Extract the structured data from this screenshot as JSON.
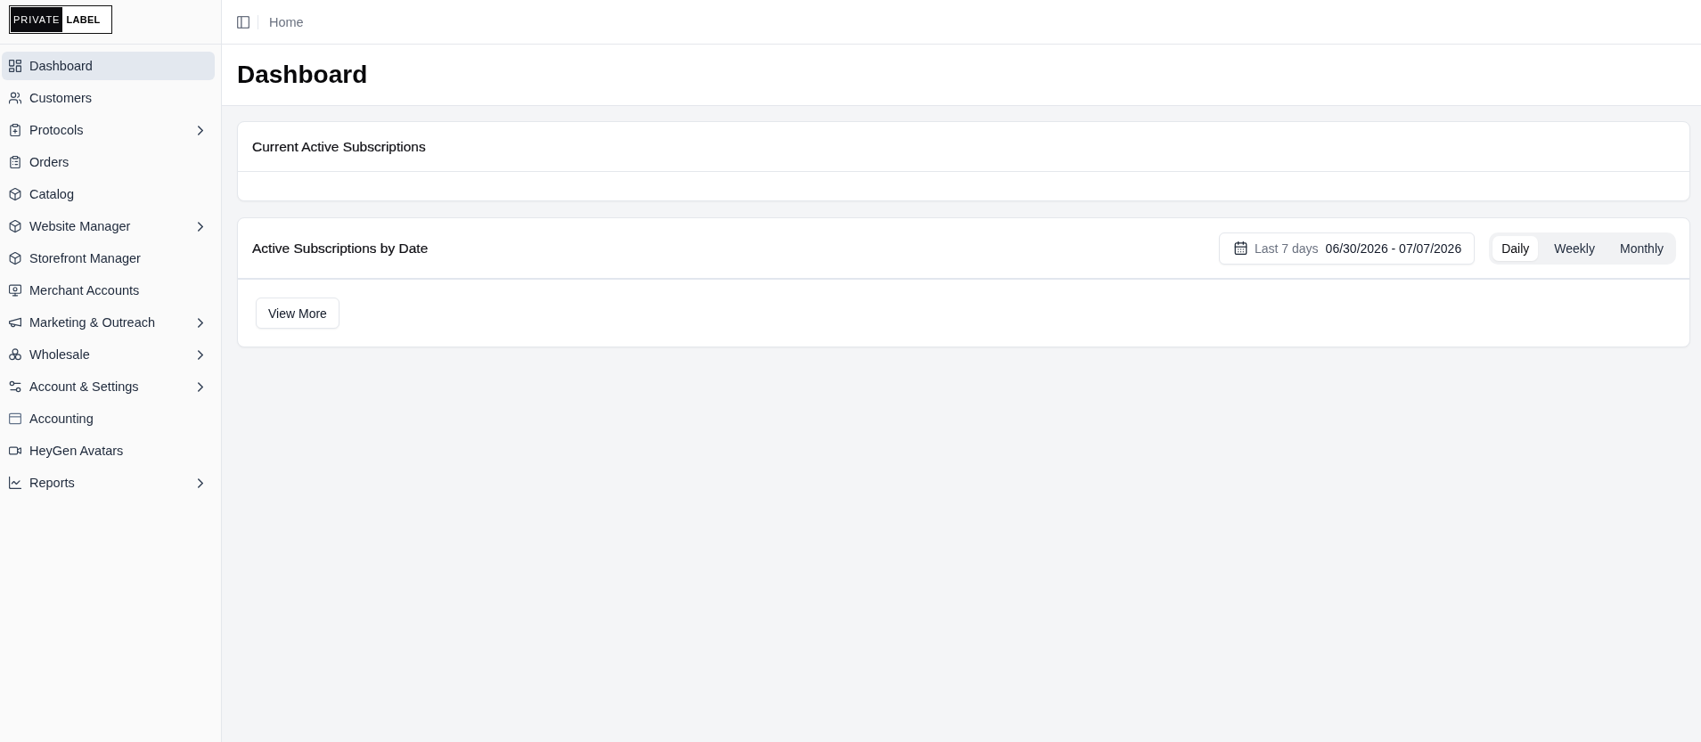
{
  "logo": {
    "inverted_text": "PRIVATE",
    "text": "LABEL"
  },
  "sidebar": {
    "items": [
      {
        "label": "Dashboard",
        "selected": true,
        "has_submenu": false
      },
      {
        "label": "Customers",
        "selected": false,
        "has_submenu": false
      },
      {
        "label": "Protocols",
        "selected": false,
        "has_submenu": true
      },
      {
        "label": "Orders",
        "selected": false,
        "has_submenu": false
      },
      {
        "label": "Catalog",
        "selected": false,
        "has_submenu": false
      },
      {
        "label": "Website Manager",
        "selected": false,
        "has_submenu": true
      },
      {
        "label": "Storefront Manager",
        "selected": false,
        "has_submenu": false
      },
      {
        "label": "Merchant Accounts",
        "selected": false,
        "has_submenu": false
      },
      {
        "label": "Marketing & Outreach",
        "selected": false,
        "has_submenu": true
      },
      {
        "label": "Wholesale",
        "selected": false,
        "has_submenu": true
      },
      {
        "label": "Account & Settings",
        "selected": false,
        "has_submenu": true
      },
      {
        "label": "Accounting",
        "selected": false,
        "has_submenu": false
      },
      {
        "label": "HeyGen Avatars",
        "selected": false,
        "has_submenu": false
      },
      {
        "label": "Reports",
        "selected": false,
        "has_submenu": true
      }
    ]
  },
  "top_bar": {
    "breadcrumb": "Home"
  },
  "page": {
    "title": "Dashboard"
  },
  "summary_card": {
    "title": "Current Active Subscriptions"
  },
  "date_card": {
    "title": "Active Subscriptions by Date",
    "date_range": {
      "preset": "Last 7 days",
      "value": "06/30/2026 - 07/07/2026"
    },
    "periods": [
      {
        "label": "Daily",
        "selected": true
      },
      {
        "label": "Weekly",
        "selected": false
      },
      {
        "label": "Monthly",
        "selected": false
      }
    ],
    "button": "View More"
  }
}
